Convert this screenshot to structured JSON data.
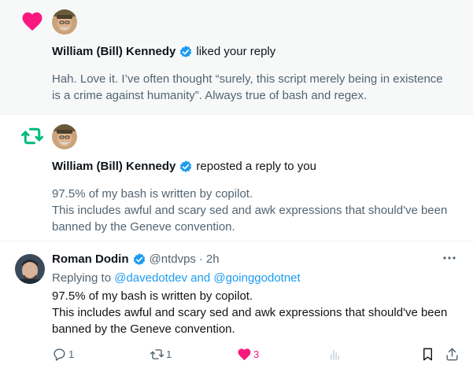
{
  "notifications": [
    {
      "type": "like",
      "user_name": "William (Bill) Kennedy",
      "action": "liked your reply",
      "text_lines": [
        "Hah. Love it. I’ve often thought “surely, this script merely being in existence",
        "is a crime against humanity”. Always true of bash and regex."
      ]
    },
    {
      "type": "repost",
      "user_name": "William (Bill) Kennedy",
      "action": "reposted a reply to you",
      "text_lines": [
        "97.5% of my bash is written by copilot.",
        "This includes awful and scary sed and awk expressions that should've been",
        "banned by the Geneve convention."
      ]
    }
  ],
  "tweet": {
    "name": "Roman Dodin",
    "handle": "@ntdvps",
    "separator": "·",
    "time": "2h",
    "replying_prefix": "Replying to",
    "replying_to": "@davedotdev and @goinggodotnet",
    "text_lines": [
      "97.5% of my bash is written by copilot.",
      "This includes awful and scary sed and awk expressions that should've been",
      "banned by the Geneve convention."
    ],
    "actions": {
      "replies": "1",
      "reposts": "1",
      "likes": "3"
    }
  },
  "colors": {
    "like": "#f91880",
    "repost": "#00ba7c",
    "verified": "#1d9bf0",
    "link": "#1d9bf0",
    "secondary_text": "#536471"
  },
  "icons": [
    "heart-icon",
    "repost-icon",
    "verified-icon",
    "more-icon",
    "reply-icon",
    "views-icon",
    "bookmark-icon",
    "share-icon"
  ]
}
